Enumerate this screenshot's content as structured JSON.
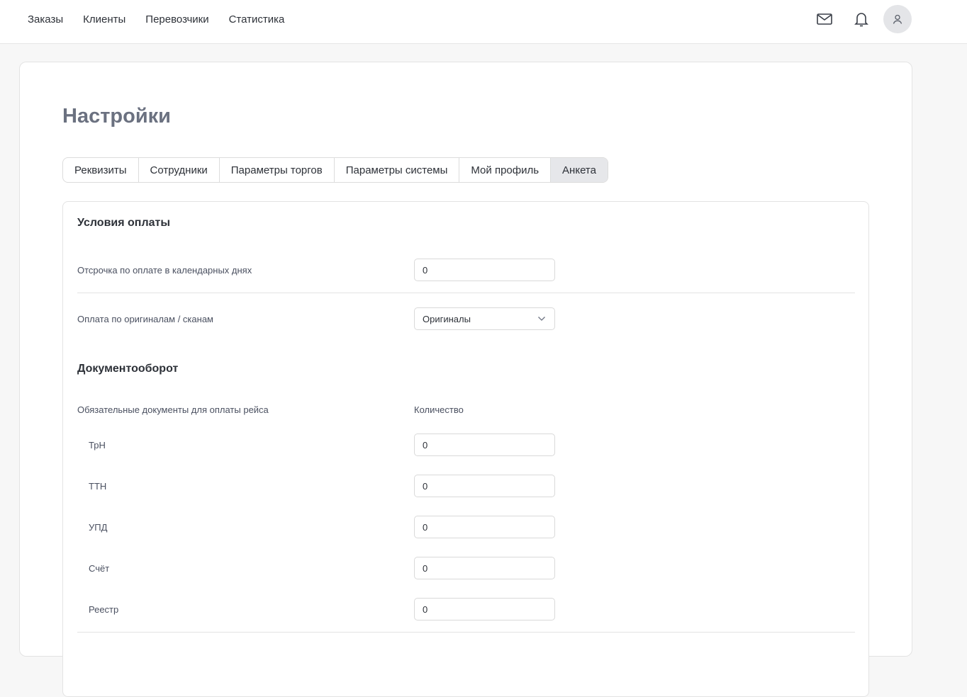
{
  "nav": {
    "items": [
      {
        "label": "Заказы"
      },
      {
        "label": "Клиенты"
      },
      {
        "label": "Перевозчики"
      },
      {
        "label": "Статистика"
      }
    ]
  },
  "header_icons": [
    "mail-icon",
    "bell-icon",
    "user-icon"
  ],
  "page": {
    "title": "Настройки"
  },
  "tabs": [
    {
      "label": "Реквизиты",
      "active": false
    },
    {
      "label": "Сотрудники",
      "active": false
    },
    {
      "label": "Параметры торгов",
      "active": false
    },
    {
      "label": "Параметры системы",
      "active": false
    },
    {
      "label": "Мой профиль",
      "active": false
    },
    {
      "label": "Анкета",
      "active": true
    }
  ],
  "payment": {
    "title": "Условия оплаты",
    "deferral_label": "Отсрочка по оплате в календарных днях",
    "deferral_value": "0",
    "originals_label": "Оплата по оригиналам / сканам",
    "originals_value": "Оригиналы"
  },
  "docs": {
    "title": "Документооборот",
    "required_label": "Обязательные документы для оплаты рейса",
    "quantity_label": "Количество",
    "items": [
      {
        "label": "ТрН",
        "value": "0"
      },
      {
        "label": "ТТН",
        "value": "0"
      },
      {
        "label": "УПД",
        "value": "0"
      },
      {
        "label": "Счёт",
        "value": "0"
      },
      {
        "label": "Реестр",
        "value": "0"
      }
    ]
  },
  "colors": {
    "accent_title": "#6b7180",
    "active_tab": "#e6e7ea"
  }
}
